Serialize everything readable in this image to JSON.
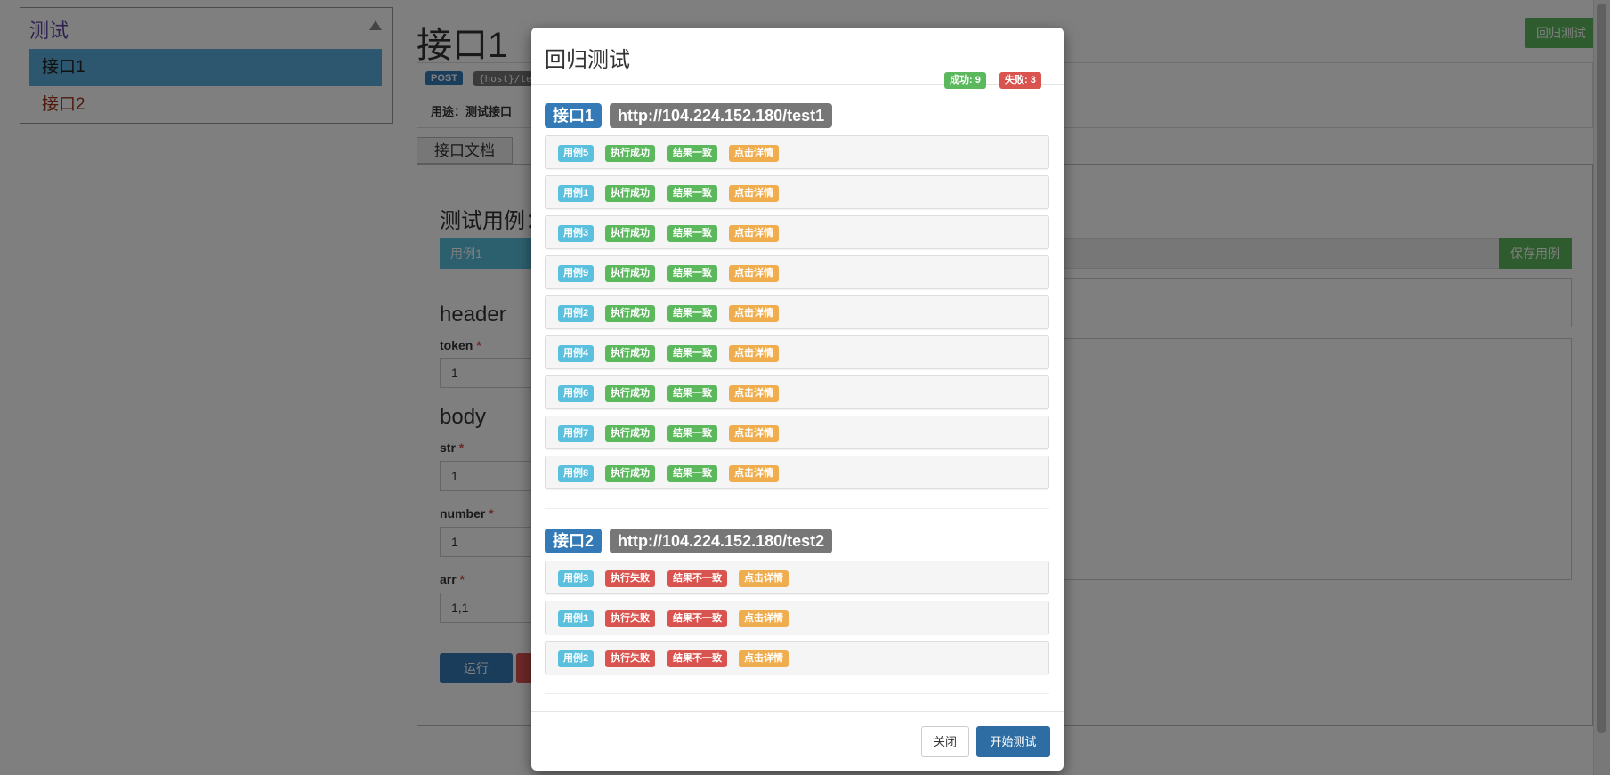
{
  "sidebar": {
    "group": "测试",
    "items": [
      {
        "label": "接口1",
        "active": true
      },
      {
        "label": "接口2",
        "active": false
      }
    ]
  },
  "page": {
    "title": "接口1",
    "regression_button": "回归测试",
    "method": "POST",
    "host": "{host}/test1",
    "usage": "用途：测试接口",
    "tab_doc": "接口文档",
    "case_title": "测试用例：",
    "case_selected": "用例1",
    "save_case": "保存用例",
    "header_title": "header",
    "body_title": "body",
    "fields": [
      {
        "label": "token",
        "value": "1"
      },
      {
        "label": "str",
        "value": "1"
      },
      {
        "label": "number",
        "value": "1"
      },
      {
        "label": "arr",
        "value": "1,1"
      }
    ],
    "required_mark": "*",
    "run_button": "运行"
  },
  "modal": {
    "title": "回归测试",
    "success_badge": "成功: 9",
    "fail_badge": "失败: 3",
    "groups": [
      {
        "name": "接口1",
        "url": "http://104.224.152.180/test1",
        "rows": [
          {
            "case": "用例5",
            "exec": "执行成功",
            "result": "结果一致",
            "detail": "点击详情",
            "ok": true
          },
          {
            "case": "用例1",
            "exec": "执行成功",
            "result": "结果一致",
            "detail": "点击详情",
            "ok": true
          },
          {
            "case": "用例3",
            "exec": "执行成功",
            "result": "结果一致",
            "detail": "点击详情",
            "ok": true
          },
          {
            "case": "用例9",
            "exec": "执行成功",
            "result": "结果一致",
            "detail": "点击详情",
            "ok": true
          },
          {
            "case": "用例2",
            "exec": "执行成功",
            "result": "结果一致",
            "detail": "点击详情",
            "ok": true
          },
          {
            "case": "用例4",
            "exec": "执行成功",
            "result": "结果一致",
            "detail": "点击详情",
            "ok": true
          },
          {
            "case": "用例6",
            "exec": "执行成功",
            "result": "结果一致",
            "detail": "点击详情",
            "ok": true
          },
          {
            "case": "用例7",
            "exec": "执行成功",
            "result": "结果一致",
            "detail": "点击详情",
            "ok": true
          },
          {
            "case": "用例8",
            "exec": "执行成功",
            "result": "结果一致",
            "detail": "点击详情",
            "ok": true
          }
        ]
      },
      {
        "name": "接口2",
        "url": "http://104.224.152.180/test2",
        "rows": [
          {
            "case": "用例3",
            "exec": "执行失败",
            "result": "结果不一致",
            "detail": "点击详情",
            "ok": false
          },
          {
            "case": "用例1",
            "exec": "执行失败",
            "result": "结果不一致",
            "detail": "点击详情",
            "ok": false
          },
          {
            "case": "用例2",
            "exec": "执行失败",
            "result": "结果不一致",
            "detail": "点击详情",
            "ok": false
          }
        ]
      }
    ],
    "close_button": "关闭",
    "start_button": "开始测试"
  },
  "colors": {
    "primary": "#337ab7",
    "success": "#5cb85c",
    "danger": "#d9534f",
    "warning": "#f0ad4e",
    "info": "#5bc0de"
  }
}
